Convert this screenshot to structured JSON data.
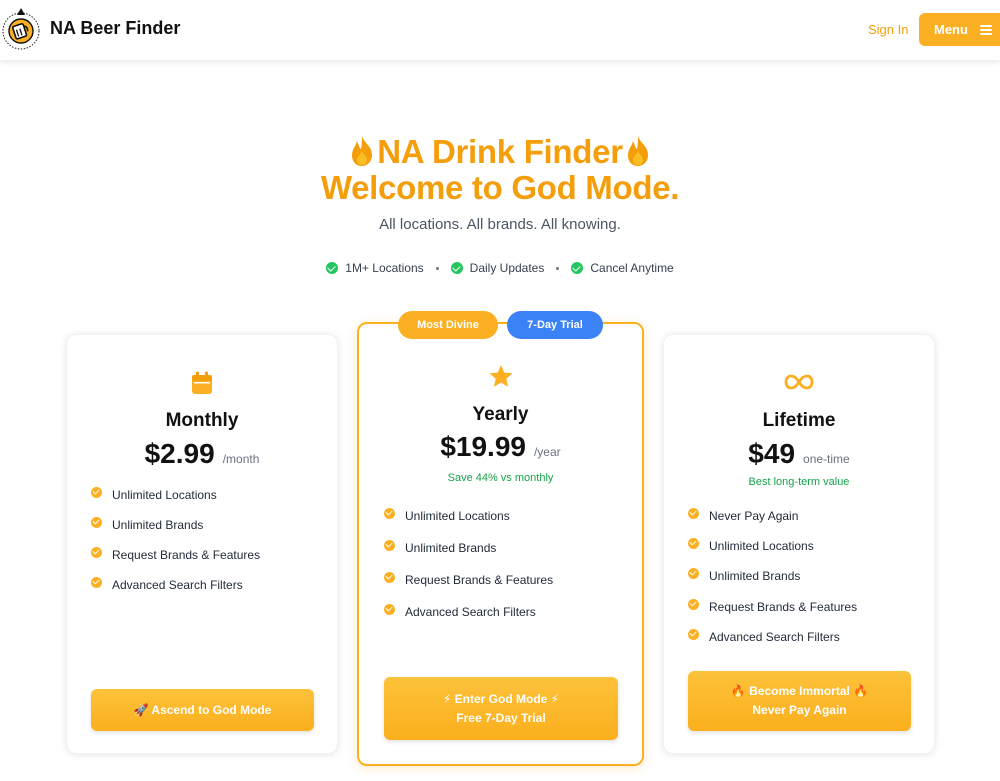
{
  "header": {
    "brand": "NA Beer Finder",
    "sign_in": "Sign In",
    "menu": "Menu"
  },
  "hero": {
    "title_line1": "NA Drink Finder",
    "title_line2": "Welcome to God Mode.",
    "tagline": "All locations. All brands. All knowing.",
    "features": [
      "1M+ Locations",
      "Daily Updates",
      "Cancel Anytime"
    ]
  },
  "badges": {
    "most_divine": "Most Divine",
    "trial": "7-Day Trial"
  },
  "plans": {
    "monthly": {
      "icon": "calendar-icon",
      "title": "Monthly",
      "price": "$2.99",
      "period": "/month",
      "features": [
        "Unlimited Locations",
        "Unlimited Brands",
        "Request Brands & Features",
        "Advanced Search Filters"
      ],
      "cta": "🚀 Ascend to God Mode"
    },
    "yearly": {
      "icon": "star-icon",
      "title": "Yearly",
      "price": "$19.99",
      "period": "/year",
      "note": "Save 44% vs monthly",
      "features": [
        "Unlimited Locations",
        "Unlimited Brands",
        "Request Brands & Features",
        "Advanced Search Filters"
      ],
      "cta_line1": "⚡ Enter God Mode ⚡",
      "cta_line2": "Free 7-Day Trial"
    },
    "lifetime": {
      "icon": "infinity-icon",
      "title": "Lifetime",
      "price": "$49",
      "period": "one-time",
      "note": "Best long-term value",
      "features": [
        "Never Pay Again",
        "Unlimited Locations",
        "Unlimited Brands",
        "Request Brands & Features",
        "Advanced Search Filters"
      ],
      "cta_line1": "🔥 Become Immortal 🔥",
      "cta_line2": "Never Pay Again"
    }
  },
  "colors": {
    "accent": "#f59e0b",
    "button": "#fbb024",
    "trial_badge": "#3b82f6",
    "check_green": "#22c55e",
    "savings_green": "#16a34a"
  }
}
